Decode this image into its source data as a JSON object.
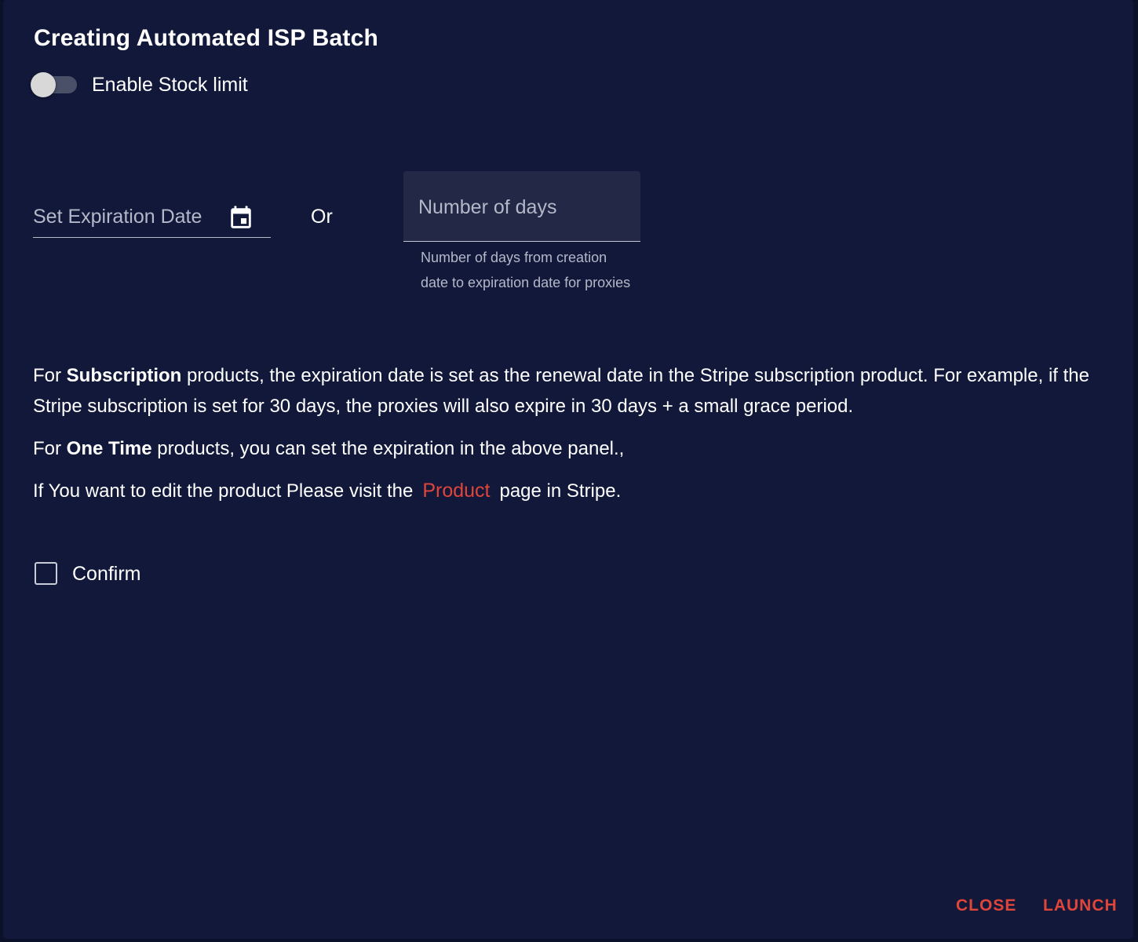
{
  "dialog": {
    "title": "Creating Automated ISP Batch"
  },
  "stock_limit": {
    "label": "Enable Stock limit",
    "enabled": false
  },
  "expiration": {
    "date_placeholder": "Set Expiration Date",
    "calendar_icon": "calendar-icon",
    "or_label": "Or",
    "days_placeholder": "Number of days",
    "days_value": "",
    "days_helper": "Number of days from creation date to expiration date for proxies"
  },
  "info": {
    "p1_prefix": "For ",
    "p1_bold": "Subscription",
    "p1_rest": " products, the expiration date is set as the renewal date in the Stripe subscription product. For example, if the Stripe subscription is set for 30 days, the proxies will also expire in 30 days + a small grace period.",
    "p2_prefix": "For ",
    "p2_bold": "One Time",
    "p2_rest": " products, you can set the expiration in the above panel.,",
    "p3_prefix": "If You want to edit the product Please visit the",
    "p3_link": "Product",
    "p3_suffix": "page in Stripe."
  },
  "confirm": {
    "label": "Confirm",
    "checked": false
  },
  "actions": {
    "close_label": "CLOSE",
    "launch_label": "LAUNCH"
  },
  "colors": {
    "background": "#12183a",
    "accent": "#e0453a",
    "text": "#ffffff",
    "muted_text": "#b4b8c8",
    "input_fill": "#222845"
  }
}
